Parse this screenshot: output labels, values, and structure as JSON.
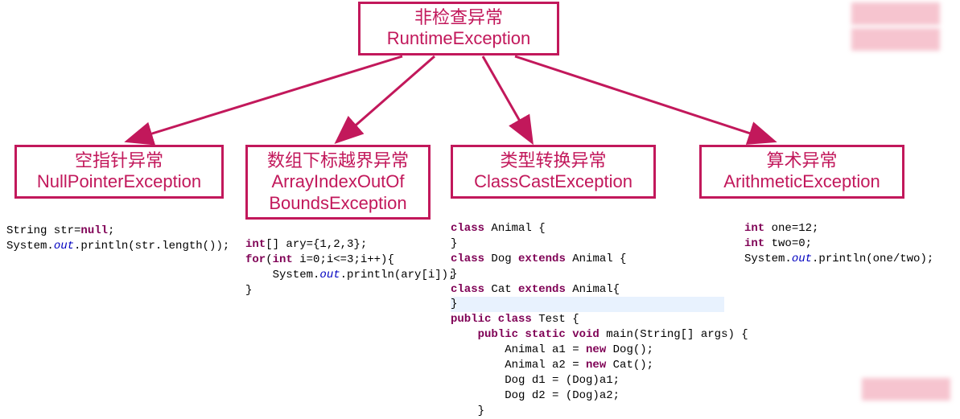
{
  "root": {
    "title_cn": "非检查异常",
    "title_en": "RuntimeException"
  },
  "children": [
    {
      "title_cn": "空指针异常",
      "title_en": "NullPointerException"
    },
    {
      "title_cn": "数组下标越界异常",
      "title_en": "ArrayIndexOutOf\nBoundsException"
    },
    {
      "title_cn": "类型转换异常",
      "title_en": "ClassCastException"
    },
    {
      "title_cn": "算术异常",
      "title_en": "ArithmeticException"
    }
  ],
  "code": {
    "npe": "String str=null;\nSystem.out.println(str.length());",
    "aioobe": "int[] ary={1,2,3};\nfor(int i=0;i<=3;i++){\n    System.out.println(ary[i]);\n}",
    "cce": "class Animal {\n}\nclass Dog extends Animal {\n}\nclass Cat extends Animal{\n}\npublic class Test {\n    public static void main(String[] args) {\n        Animal a1 = new Dog();\n        Animal a2 = new Cat();\n        Dog d1 = (Dog)a1;\n        Dog d2 = (Dog)a2;\n    }",
    "ae": "int one=12;\nint two=0;\nSystem.out.println(one/two);"
  }
}
